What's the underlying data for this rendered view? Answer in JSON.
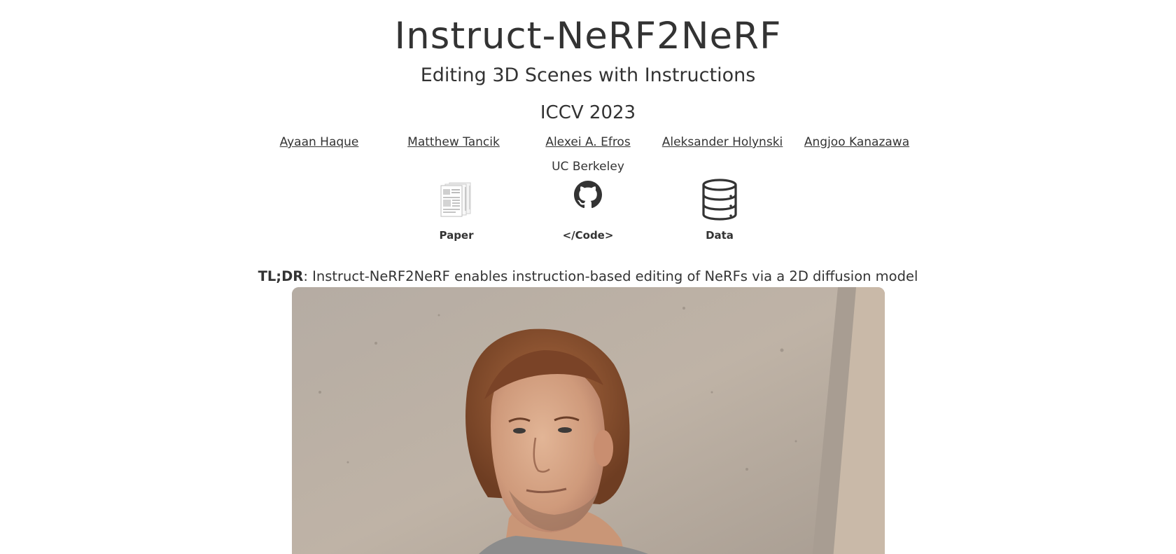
{
  "header": {
    "title": "Instruct-NeRF2NeRF",
    "subtitle": "Editing 3D Scenes with Instructions",
    "venue": "ICCV 2023"
  },
  "authors": [
    {
      "name": "Ayaan Haque"
    },
    {
      "name": "Matthew Tancik"
    },
    {
      "name": "Alexei A. Efros"
    },
    {
      "name": "Aleksander Holynski"
    },
    {
      "name": "Angjoo Kanazawa"
    }
  ],
  "affiliation": "UC Berkeley",
  "links": [
    {
      "label": "Paper",
      "icon": "paper-thumbnail-icon"
    },
    {
      "label": "</Code>",
      "icon": "github-icon"
    },
    {
      "label": "Data",
      "icon": "database-icon"
    }
  ],
  "tldr": {
    "prefix": "TL;DR",
    "text": ": Instruct-NeRF2NeRF enables instruction-based editing of NeRFs via a 2D diffusion model"
  },
  "colors": {
    "text": "#333333",
    "background": "#ffffff"
  }
}
